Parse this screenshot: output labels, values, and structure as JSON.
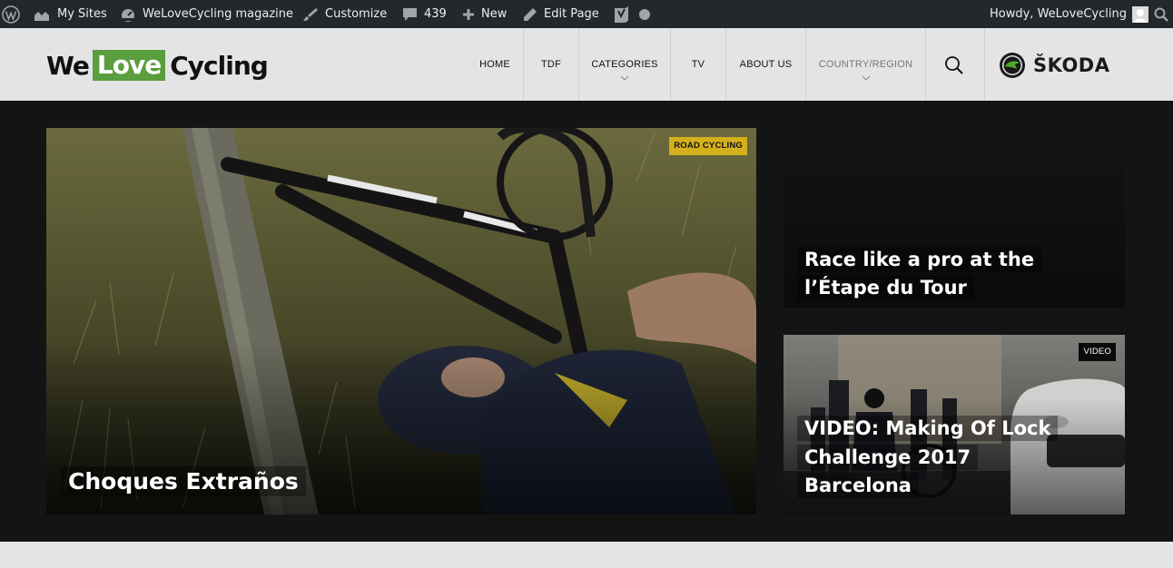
{
  "admin_bar": {
    "my_sites": "My Sites",
    "site_name": "WeLoveCycling magazine",
    "customize": "Customize",
    "comments_count": "439",
    "new": "New",
    "edit_page": "Edit Page",
    "howdy": "Howdy, WeLoveCycling"
  },
  "logo": {
    "we": "We",
    "love": "Love",
    "cycling": "Cycling"
  },
  "nav": {
    "items": [
      {
        "label": "HOME"
      },
      {
        "label": "TDF"
      },
      {
        "label": "CATEGORIES"
      },
      {
        "label": "TV"
      },
      {
        "label": "ABOUT US"
      },
      {
        "label": "COUNTRY/REGION"
      }
    ]
  },
  "sponsor": {
    "name": "ŠKODA"
  },
  "hero": {
    "main": {
      "tag": "ROAD CYCLING",
      "title": "Choques Extraños"
    },
    "top": {
      "title_line1": "Race like a pro at the",
      "title_line2": "l’Étape du Tour"
    },
    "bottom": {
      "tag": "VIDEO",
      "title_line1": "VIDEO: Making Of Lock",
      "title_line2": "Challenge 2017",
      "title_line3": "Barcelona"
    }
  },
  "colors": {
    "admin_bar": "#23282d",
    "logo_green": "#5a9e3e",
    "tag_yellow": "#d4b01c",
    "hero_bg": "#131515"
  }
}
